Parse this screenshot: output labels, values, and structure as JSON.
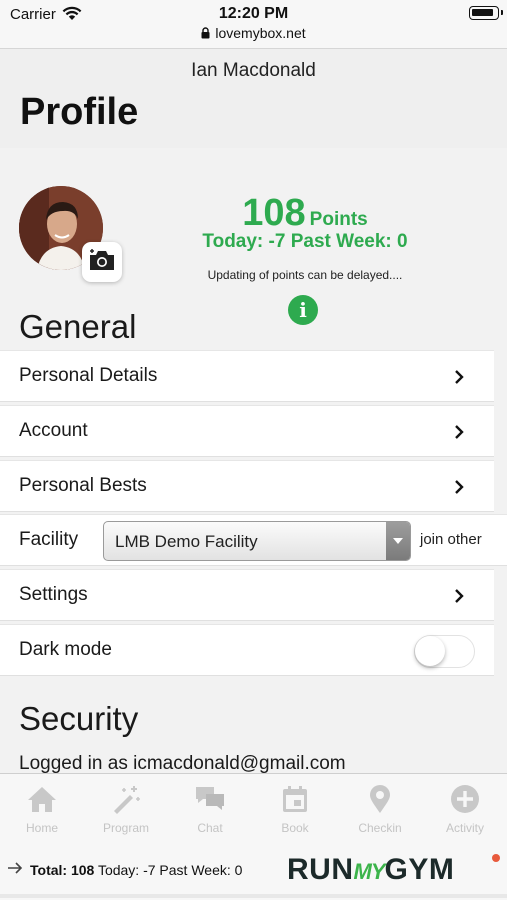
{
  "status_bar": {
    "carrier": "Carrier",
    "time": "12:20 PM",
    "url": "lovemybox.net"
  },
  "header": {
    "user_name": "Ian Macdonald",
    "title": "Profile"
  },
  "points": {
    "total": "108",
    "label": "Points",
    "today_past_week": "Today: -7 Past Week: 0",
    "delay_note": "Updating of points can be delayed....",
    "info_glyph": "i"
  },
  "general": {
    "title": "General",
    "rows": [
      {
        "label": "Personal Details"
      },
      {
        "label": "Account"
      },
      {
        "label": "Personal Bests"
      }
    ],
    "facility": {
      "label": "Facility",
      "selected": "LMB Demo Facility",
      "join_other": "join other"
    },
    "settings": {
      "label": "Settings"
    },
    "dark_mode": {
      "label": "Dark mode",
      "on": false
    }
  },
  "security": {
    "title": "Security",
    "logged_in": "Logged in as icmacdonald@gmail.com"
  },
  "tabbar": {
    "tabs": [
      {
        "label": "Home",
        "icon": "home-icon"
      },
      {
        "label": "Program",
        "icon": "magic-wand-icon"
      },
      {
        "label": "Chat",
        "icon": "chat-icon"
      },
      {
        "label": "Book",
        "icon": "calendar-icon"
      },
      {
        "label": "Checkin",
        "icon": "map-pin-icon"
      },
      {
        "label": "Activity",
        "icon": "plus-circle-icon"
      }
    ]
  },
  "summary": {
    "total_label": "Total: 108",
    "today": "Today: -7 Past Week: 0"
  },
  "brand": {
    "part1": "RUN",
    "part2": "MY",
    "part3": "GYM"
  },
  "colors": {
    "accent_green": "#2eaa4f",
    "tab_inactive": "#c4c4c4",
    "brand_dot": "#e85a3c"
  }
}
